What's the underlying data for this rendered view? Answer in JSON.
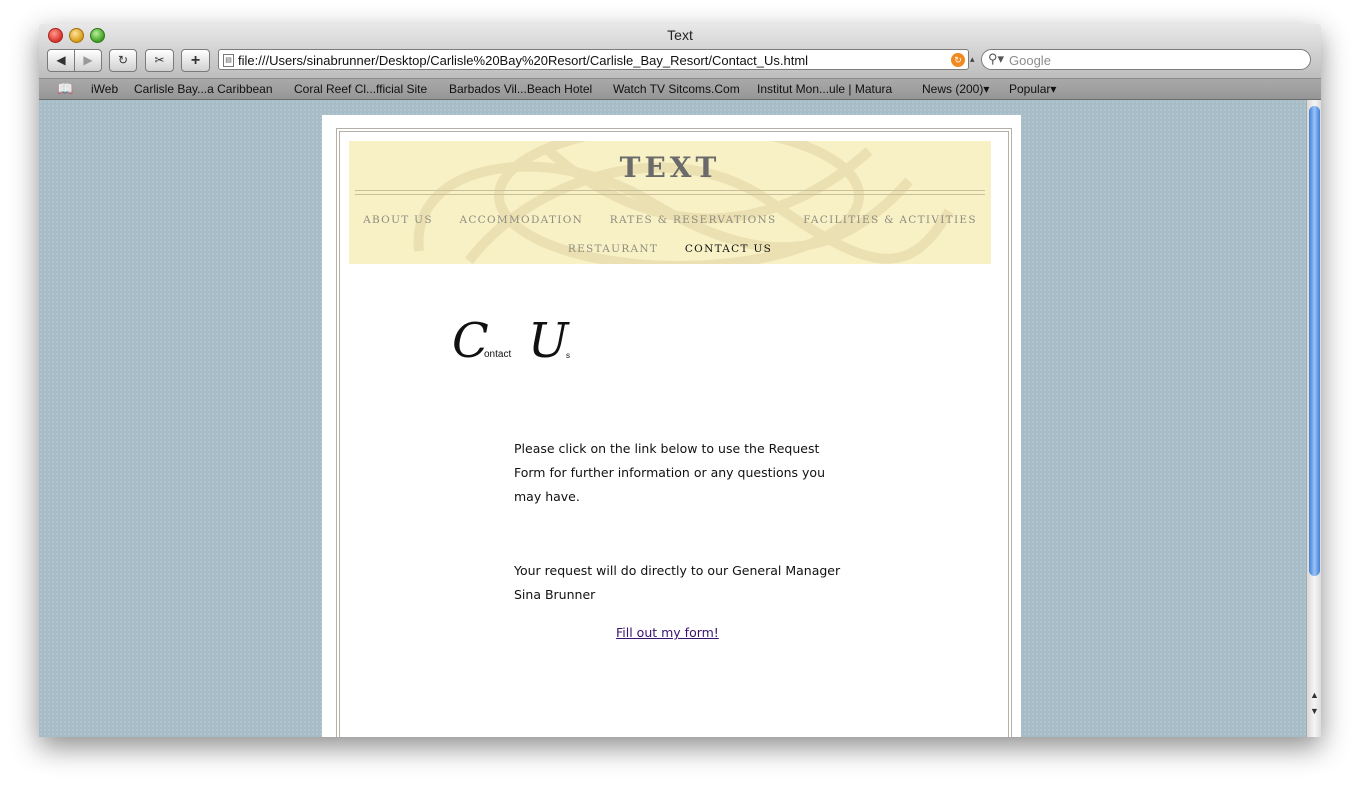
{
  "window": {
    "title": "Text"
  },
  "toolbar": {
    "back_glyph": "◀",
    "forward_glyph": "▶",
    "reload_glyph": "↻",
    "snip_glyph": "✂",
    "add_bookmark_glyph": "+",
    "url": "file:///Users/sinabrunner/Desktop/Carlisle%20Bay%20Resort/Carlisle_Bay_Resort/Contact_Us.html",
    "search_placeholder": "Google"
  },
  "bookmarks": [
    "iWeb",
    "Carlisle Bay...a Caribbean",
    "Coral Reef Cl...fficial Site",
    "Barbados Vil...Beach Hotel",
    "Watch TV Sitcoms.Com",
    "Institut Mon...ule | Matura",
    "News (200)▾",
    "Popular▾"
  ],
  "site": {
    "title": "TEXT",
    "nav_row1": [
      "ABOUT US",
      "ACCOMMODATION",
      "RATES & RESERVATIONS",
      "FACILITIES & ACTIVITIES"
    ],
    "nav_row2": [
      "RESTAURANT",
      "CONTACT US"
    ],
    "active_nav": "CONTACT US"
  },
  "heading": {
    "c": "C",
    "ontact": "ontact",
    "u": "U",
    "s": "s"
  },
  "body": {
    "para1": "Please click on the link below to use the Request Form for further information or any questions you may have.",
    "para2": "Your request will do directly to our General Manager Sina Brunner",
    "link": "Fill out my form!"
  },
  "colors": {
    "page_bg": "#a6bcc6",
    "banner": "#f8f1c6",
    "link": "#3a146e"
  }
}
